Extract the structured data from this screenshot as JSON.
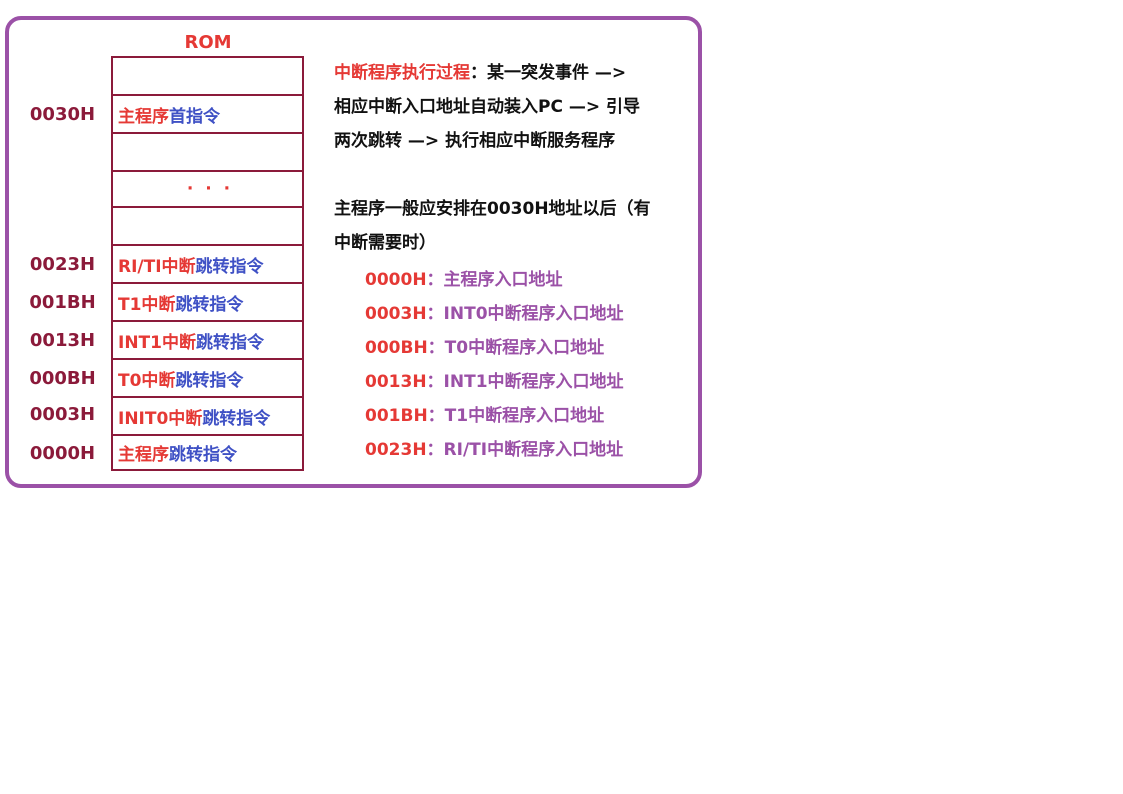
{
  "rom_title": "ROM",
  "rom_cells": [
    {
      "red": "",
      "blue": ""
    },
    {
      "red": "主程序",
      "blue": "首指令"
    },
    {
      "red": "",
      "blue": ""
    },
    {
      "dots": "· · ·"
    },
    {
      "red": "",
      "blue": ""
    },
    {
      "red": "RI/TI中断",
      "blue": "跳转指令"
    },
    {
      "red": "T1中断",
      "blue": "跳转指令"
    },
    {
      "red": "INT1中断",
      "blue": "跳转指令"
    },
    {
      "red": "T0中断",
      "blue": "跳转指令"
    },
    {
      "red": "INIT0中断",
      "blue": "跳转指令"
    },
    {
      "red": "主程序",
      "blue": "跳转指令"
    }
  ],
  "addresses": [
    "0030H",
    "0023H",
    "001BH",
    "0013H",
    "000BH",
    "0003H",
    "0000H"
  ],
  "description": {
    "process_title": "中断程序执行过程",
    "process_line1_rest": "：某一突发事件 —>",
    "process_line2": "相应中断入口地址自动装入PC —> 引导",
    "process_line3": "两次跳转 —> 执行相应中断服务程序",
    "note_line1": "主程序一般应安排在0030H地址以后（有",
    "note_line2": "中断需要时）"
  },
  "vectors": [
    {
      "addr": "0000H",
      "sep": "：",
      "desc": "主程序入口地址"
    },
    {
      "addr": "0003H",
      "sep": "：",
      "desc": "INT0中断程序入口地址"
    },
    {
      "addr": "000BH",
      "sep": "：",
      "desc": "T0中断程序入口地址"
    },
    {
      "addr": "0013H",
      "sep": "：",
      "desc": "INT1中断程序入口地址"
    },
    {
      "addr": "001BH",
      "sep": "：",
      "desc": "T1中断程序入口地址"
    },
    {
      "addr": "0023H",
      "sep": "：",
      "desc": "RI/TI中断程序入口地址"
    }
  ],
  "colors": {
    "frame": "#9b51a7",
    "red": "#e53935",
    "blue": "#3f51c5",
    "maroon": "#8b1a3a",
    "purple": "#9b51a7"
  }
}
